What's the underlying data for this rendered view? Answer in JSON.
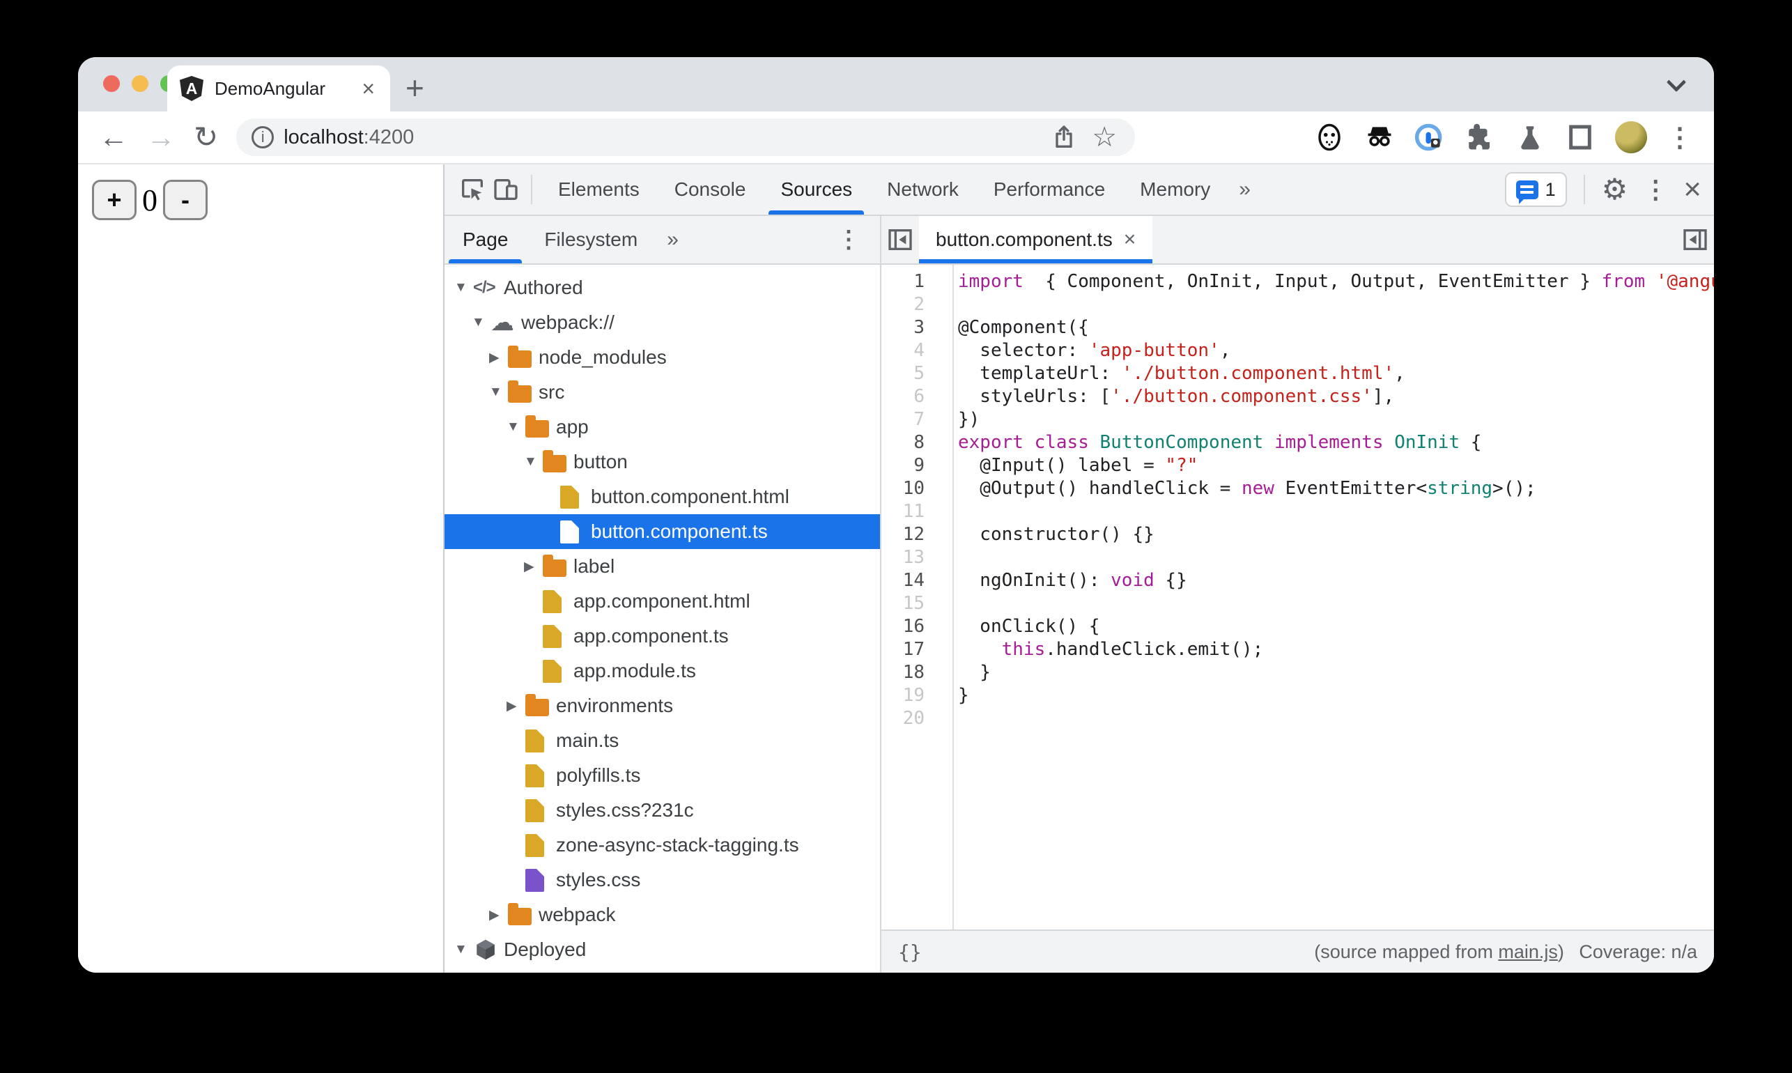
{
  "browser": {
    "tab_title": "DemoAngular",
    "tab_close": "×",
    "new_tab": "+",
    "favicon_letter": "A",
    "back": "←",
    "forward": "→",
    "reload": "↻",
    "url_host": "localhost",
    "url_port": ":4200",
    "bookmark_star": "☆"
  },
  "page": {
    "increment_label": "+",
    "counter_value": "0",
    "decrement_label": "-"
  },
  "devtools": {
    "panel_tabs": [
      "Elements",
      "Console",
      "Sources",
      "Network",
      "Performance",
      "Memory"
    ],
    "active_panel": "Sources",
    "overflow_tabs": "»",
    "issues_count": "1",
    "settings_gear": "⚙",
    "kebab": "⋮",
    "close": "×",
    "navigator": {
      "tabs": [
        "Page",
        "Filesystem"
      ],
      "active_tab": "Page",
      "overflow_tabs": "»",
      "kebab": "⋮",
      "tree": [
        {
          "label": "Authored",
          "level": 0,
          "arrow": "down",
          "icon": "code-icon"
        },
        {
          "label": "webpack://",
          "level": 1,
          "arrow": "down",
          "icon": "cloud-icon"
        },
        {
          "label": "node_modules",
          "level": 2,
          "arrow": "right",
          "icon": "folder-icon"
        },
        {
          "label": "src",
          "level": 2,
          "arrow": "down",
          "icon": "folder-icon"
        },
        {
          "label": "app",
          "level": 3,
          "arrow": "down",
          "icon": "folder-icon"
        },
        {
          "label": "button",
          "level": 4,
          "arrow": "down",
          "icon": "folder-icon"
        },
        {
          "label": "button.component.html",
          "level": 5,
          "arrow": "none",
          "icon": "file-icon"
        },
        {
          "label": "button.component.ts",
          "level": 5,
          "arrow": "none",
          "icon": "file-icon",
          "selected": true
        },
        {
          "label": "label",
          "level": 4,
          "arrow": "right",
          "icon": "folder-icon"
        },
        {
          "label": "app.component.html",
          "level": 4,
          "arrow": "none",
          "icon": "file-icon"
        },
        {
          "label": "app.component.ts",
          "level": 4,
          "arrow": "none",
          "icon": "file-icon"
        },
        {
          "label": "app.module.ts",
          "level": 4,
          "arrow": "none",
          "icon": "file-icon"
        },
        {
          "label": "environments",
          "level": 3,
          "arrow": "right",
          "icon": "folder-icon"
        },
        {
          "label": "main.ts",
          "level": 3,
          "arrow": "none",
          "icon": "file-icon"
        },
        {
          "label": "polyfills.ts",
          "level": 3,
          "arrow": "none",
          "icon": "file-icon"
        },
        {
          "label": "styles.css?231c",
          "level": 3,
          "arrow": "none",
          "icon": "file-icon"
        },
        {
          "label": "zone-async-stack-tagging.ts",
          "level": 3,
          "arrow": "none",
          "icon": "file-icon"
        },
        {
          "label": "styles.css",
          "level": 3,
          "arrow": "none",
          "icon": "file-purple-icon"
        },
        {
          "label": "webpack",
          "level": 2,
          "arrow": "right",
          "icon": "folder-icon"
        },
        {
          "label": "Deployed",
          "level": 0,
          "arrow": "down",
          "icon": "cube-icon"
        },
        {
          "label": "",
          "level": 1,
          "arrow": "none",
          "icon": "frame-icon"
        }
      ]
    },
    "editor": {
      "tab_label": "button.component.ts",
      "tab_close": "×",
      "code_lines": [
        {
          "n": 1,
          "g": "d",
          "segs": [
            [
              "kw",
              "import"
            ],
            [
              "",
              "  { Component, OnInit, Input, Output, EventEmitter } "
            ],
            [
              "kw",
              "from"
            ],
            [
              "",
              " "
            ],
            [
              "str",
              "'@angular/core';"
            ]
          ]
        },
        {
          "n": 2,
          "g": "l",
          "segs": []
        },
        {
          "n": 3,
          "g": "d",
          "segs": [
            [
              "",
              "@Component({"
            ]
          ]
        },
        {
          "n": 4,
          "g": "l",
          "segs": [
            [
              "",
              "  selector: "
            ],
            [
              "str",
              "'app-button'"
            ],
            [
              "",
              ","
            ]
          ]
        },
        {
          "n": 5,
          "g": "l",
          "segs": [
            [
              "",
              "  templateUrl: "
            ],
            [
              "str",
              "'./button.component.html'"
            ],
            [
              "",
              ","
            ]
          ]
        },
        {
          "n": 6,
          "g": "l",
          "segs": [
            [
              "",
              "  styleUrls: ["
            ],
            [
              "str",
              "'./button.component.css'"
            ],
            [
              "",
              "],"
            ]
          ]
        },
        {
          "n": 7,
          "g": "l",
          "segs": [
            [
              "",
              "})"
            ]
          ]
        },
        {
          "n": 8,
          "g": "d",
          "segs": [
            [
              "kw",
              "export"
            ],
            [
              "",
              " "
            ],
            [
              "kw",
              "class"
            ],
            [
              "",
              " "
            ],
            [
              "type",
              "ButtonComponent"
            ],
            [
              "",
              " "
            ],
            [
              "kw",
              "implements"
            ],
            [
              "",
              " "
            ],
            [
              "type",
              "OnInit"
            ],
            [
              "",
              " {"
            ]
          ]
        },
        {
          "n": 9,
          "g": "d",
          "segs": [
            [
              "",
              "  @Input() label = "
            ],
            [
              "str",
              "\"?\""
            ]
          ]
        },
        {
          "n": 10,
          "g": "d",
          "segs": [
            [
              "",
              "  @Output() handleClick = "
            ],
            [
              "kw",
              "new"
            ],
            [
              "",
              " EventEmitter<"
            ],
            [
              "type",
              "string"
            ],
            [
              "",
              ">();"
            ]
          ]
        },
        {
          "n": 11,
          "g": "l",
          "segs": []
        },
        {
          "n": 12,
          "g": "d",
          "segs": [
            [
              "",
              "  constructor() {}"
            ]
          ]
        },
        {
          "n": 13,
          "g": "l",
          "segs": []
        },
        {
          "n": 14,
          "g": "d",
          "segs": [
            [
              "",
              "  ngOnInit(): "
            ],
            [
              "kw",
              "void"
            ],
            [
              "",
              " {}"
            ]
          ]
        },
        {
          "n": 15,
          "g": "l",
          "segs": []
        },
        {
          "n": 16,
          "g": "d",
          "segs": [
            [
              "",
              "  onClick() {"
            ]
          ]
        },
        {
          "n": 17,
          "g": "d",
          "segs": [
            [
              "",
              "    "
            ],
            [
              "kw",
              "this"
            ],
            [
              "",
              ".handleClick.emit();"
            ]
          ]
        },
        {
          "n": 18,
          "g": "d",
          "segs": [
            [
              "",
              "  }"
            ]
          ]
        },
        {
          "n": 19,
          "g": "l",
          "segs": [
            [
              "",
              "}"
            ]
          ]
        },
        {
          "n": 20,
          "g": "l",
          "segs": []
        }
      ],
      "statusbar": {
        "pretty_print": "{}",
        "mapped_prefix": "(source mapped from ",
        "mapped_link": "main.js",
        "mapped_suffix": ") ",
        "coverage": "Coverage: n/a"
      }
    }
  },
  "colors": {
    "accent_blue": "#1a73e8",
    "selected_row": "#1a73e8",
    "folder": "#e2871f",
    "file": "#d9a827",
    "file_purple": "#7a52c9",
    "keyword": "#a71d96",
    "string": "#c5221c",
    "type": "#0f8271"
  }
}
